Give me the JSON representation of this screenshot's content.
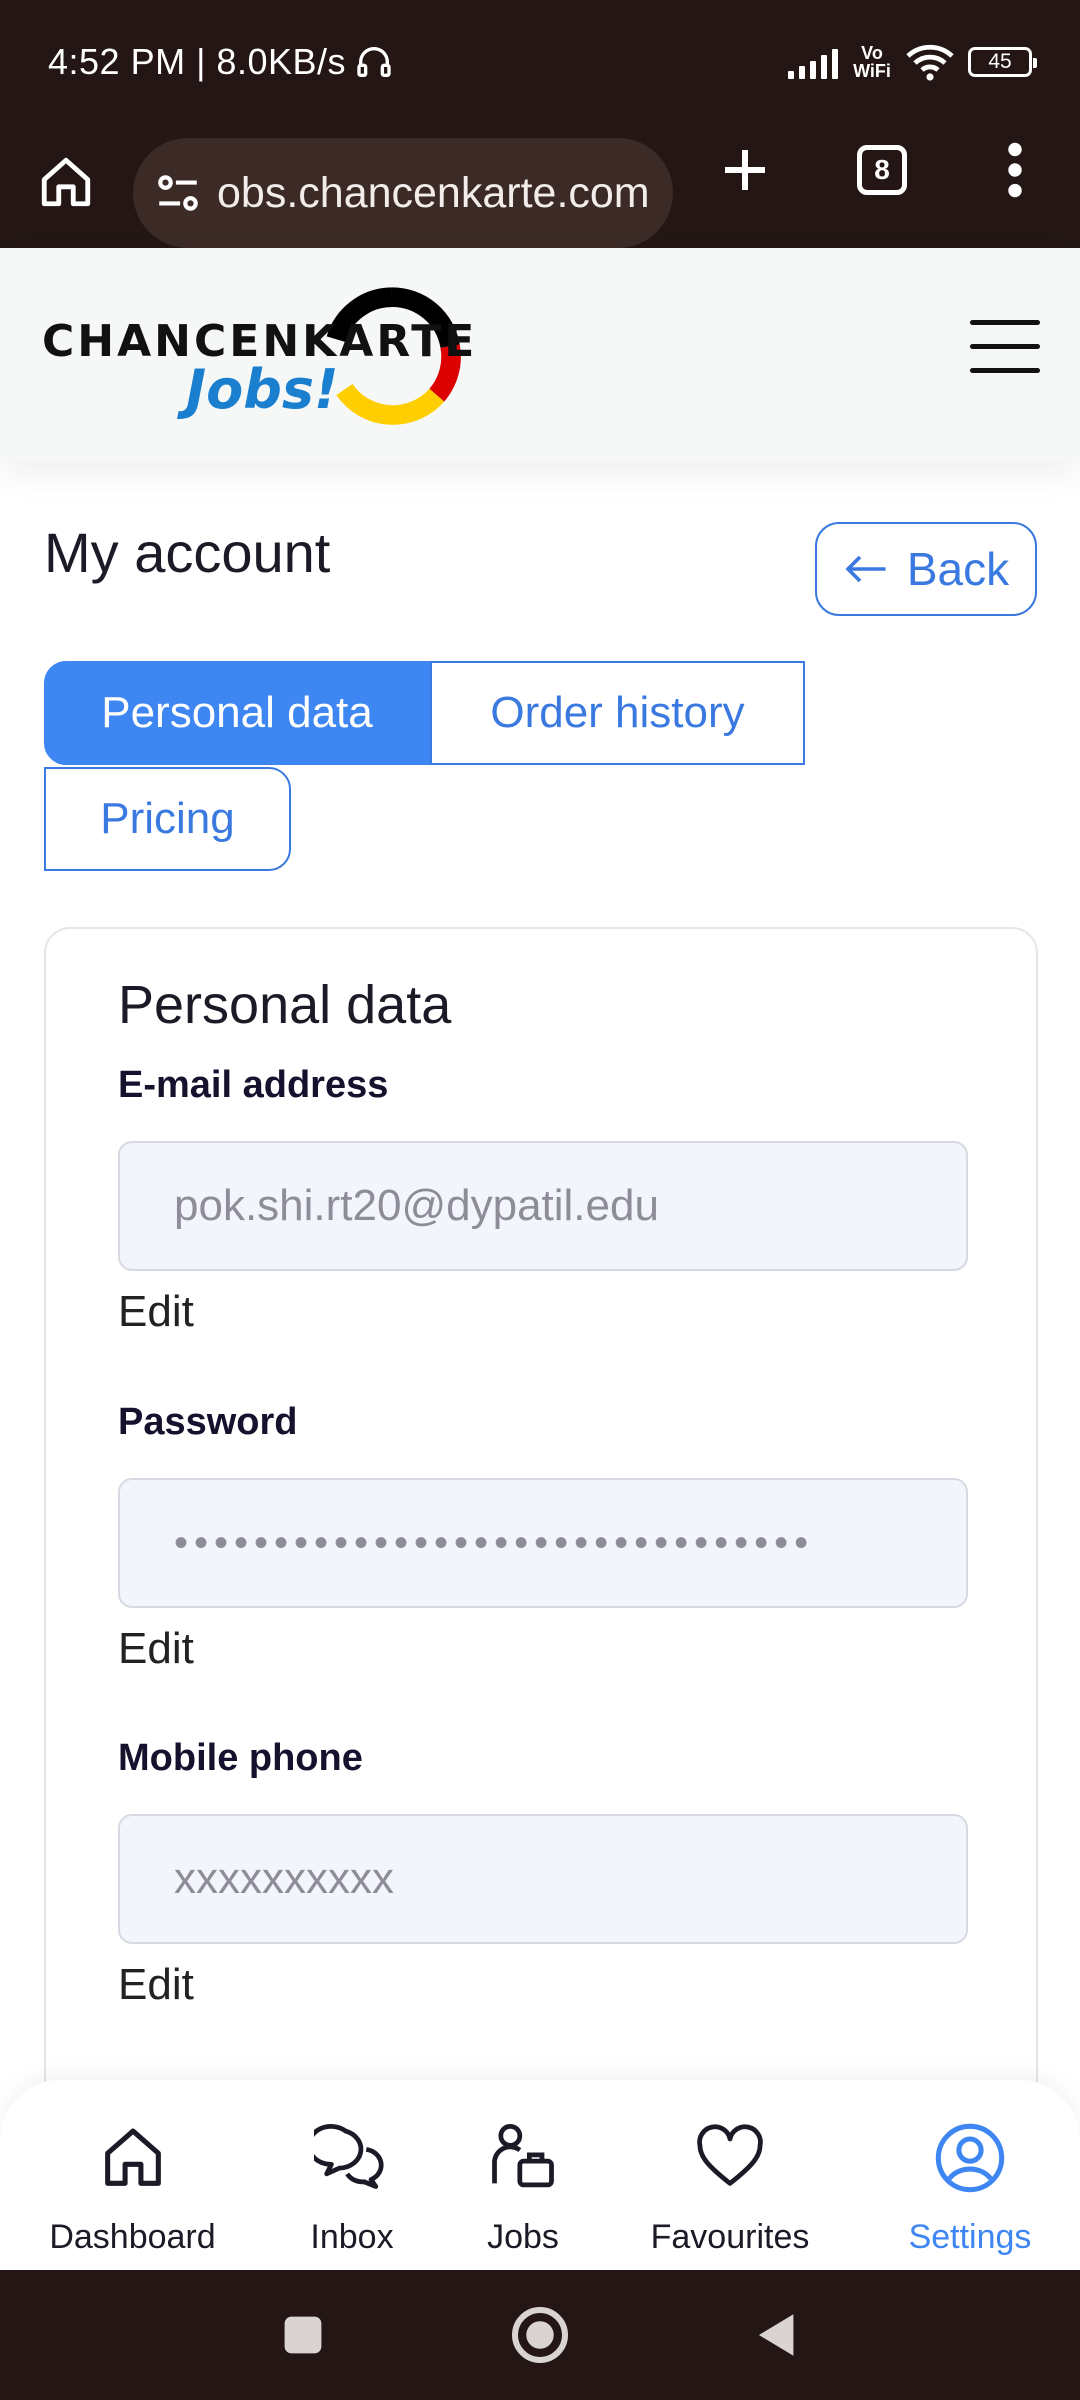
{
  "status_bar": {
    "time": "4:52 PM | 8.0KB/s",
    "network_label": "Vo WiFi",
    "battery": "45"
  },
  "browser": {
    "url": "obs.chancenkarte.com",
    "tab_count": "8"
  },
  "site": {
    "logo_main": "CHANCENKARTE",
    "logo_sub": "Jobs!"
  },
  "page": {
    "title": "My account",
    "back_label": "Back"
  },
  "tabs": [
    {
      "label": "Personal data",
      "active": true
    },
    {
      "label": "Order history",
      "active": false
    },
    {
      "label": "Pricing",
      "active": false
    }
  ],
  "card": {
    "title": "Personal data",
    "fields": [
      {
        "label": "E-mail address",
        "value": "pok.shi.rt20@dypatil.edu",
        "edit": "Edit"
      },
      {
        "label": "Password",
        "value": "••••••••••••••••••••••••••••••••",
        "edit": "Edit"
      },
      {
        "label": "Mobile phone",
        "value": "xxxxxxxxxx",
        "edit": "Edit"
      }
    ]
  },
  "bottom_nav": [
    {
      "label": "Dashboard",
      "icon": "home-icon",
      "active": false
    },
    {
      "label": "Inbox",
      "icon": "chat-icon",
      "active": false
    },
    {
      "label": "Jobs",
      "icon": "jobs-icon",
      "active": false
    },
    {
      "label": "Favourites",
      "icon": "heart-icon",
      "active": false
    },
    {
      "label": "Settings",
      "icon": "user-circle-icon",
      "active": true
    }
  ],
  "colors": {
    "accent": "#3e86f2",
    "dark_bar": "#231614",
    "logo_blue": "#1a7fcf",
    "flag_black": "#000000",
    "flag_red": "#dd0000",
    "flag_gold": "#ffce00"
  }
}
